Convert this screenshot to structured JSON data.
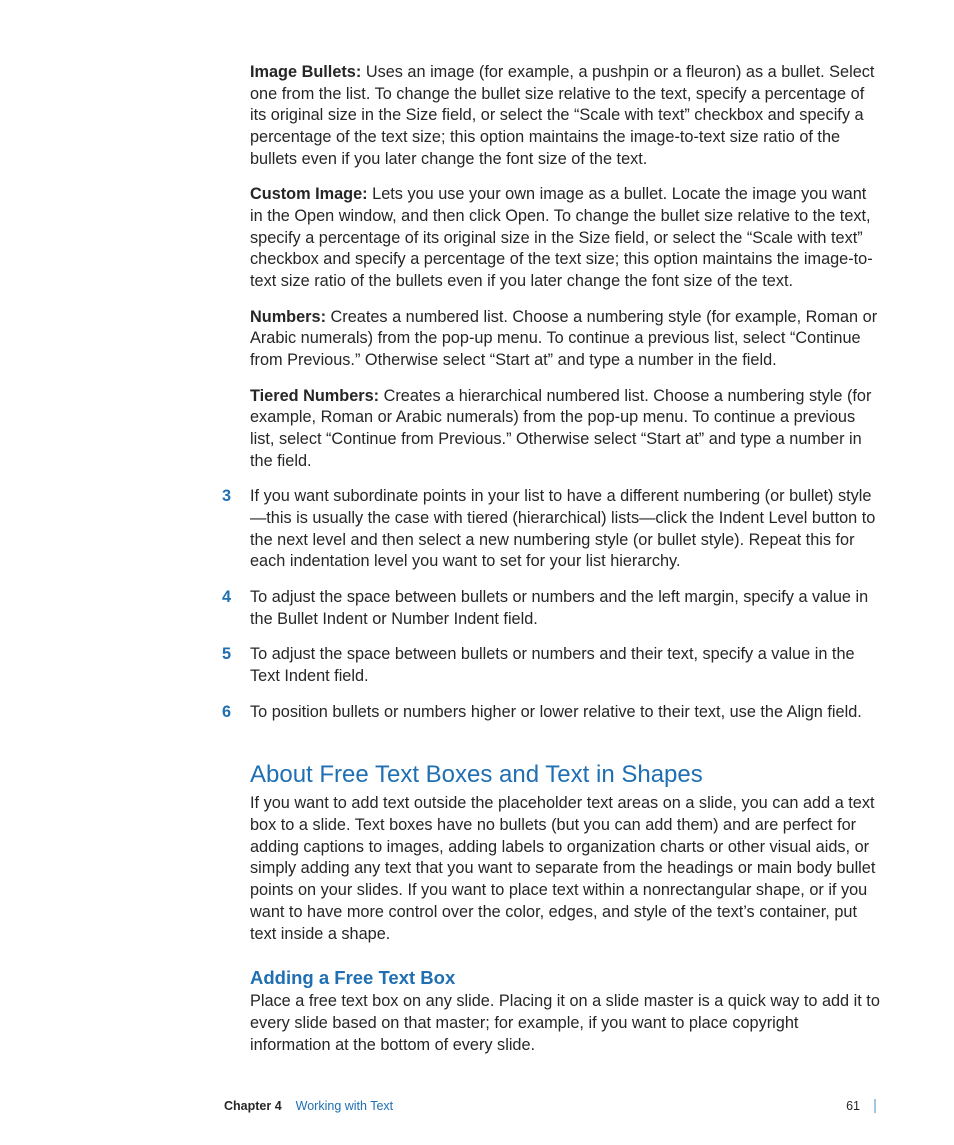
{
  "paragraphs": {
    "imageBullets": {
      "label": "Image Bullets:  ",
      "text": "Uses an image (for example, a pushpin or a fleuron) as a bullet. Select one from the list. To change the bullet size relative to the text, specify a percentage of its original size in the Size field, or select the “Scale with text” checkbox and specify a percentage of the text size; this option maintains the image-to-text size ratio of the bullets even if you later change the font size of the text."
    },
    "customImage": {
      "label": "Custom Image:  ",
      "text": "Lets you use your own image as a bullet. Locate the image you want in the Open window, and then click Open. To change the bullet size relative to the text, specify a percentage of its original size in the Size field, or select the “Scale with text” checkbox and specify a percentage of the text size; this option maintains the image-to-text size ratio of the bullets even if you later change the font size of the text."
    },
    "numbers": {
      "label": "Numbers:  ",
      "text": "Creates a numbered list. Choose a numbering style (for example, Roman or Arabic numerals) from the pop-up menu. To continue a previous list, select “Continue from Previous.” Otherwise select “Start at” and type a number in the field."
    },
    "tiered": {
      "label": "Tiered Numbers:  ",
      "text": "Creates a hierarchical numbered list. Choose a numbering style (for example, Roman or Arabic numerals) from the pop-up menu. To continue a previous list, select “Continue from Previous.” Otherwise select “Start at” and type a number in the field."
    }
  },
  "steps": {
    "s3": {
      "n": "3",
      "t": "If you want subordinate points in your list to have a different numbering (or bullet) style—this is usually the case with tiered (hierarchical) lists—click the Indent Level button to the next level and then select a new numbering style (or bullet style). Repeat this for each indentation level you want to set for your list hierarchy."
    },
    "s4": {
      "n": "4",
      "t": "To adjust the space between bullets or numbers and the left margin, specify a value in the Bullet Indent or Number Indent field."
    },
    "s5": {
      "n": "5",
      "t": "To adjust the space between bullets or numbers and their text, specify a value in the Text Indent field."
    },
    "s6": {
      "n": "6",
      "t": "To position bullets or numbers higher or lower relative to their text, use the Align field."
    }
  },
  "section": {
    "heading": "About Free Text Boxes and Text in Shapes",
    "body": "If you want to add text outside the placeholder text areas on a slide, you can add a text box to a slide. Text boxes have no bullets (but you can add them) and are perfect for adding captions to images, adding labels to organization charts or other visual aids, or simply adding any text that you want to separate from the headings or main body bullet points on your slides. If you want to place text within a nonrectangular shape, or if you want to have more control over the color, edges, and style of the text’s container, put text inside a shape.",
    "sub": {
      "heading": "Adding a Free Text Box",
      "body": "Place a free text box on any slide. Placing it on a slide master is a quick way to add it to every slide based on that master; for example, if you want to place copyright information at the bottom of every slide."
    }
  },
  "footer": {
    "chapter": "Chapter 4",
    "title": "Working with Text",
    "page": "61"
  }
}
